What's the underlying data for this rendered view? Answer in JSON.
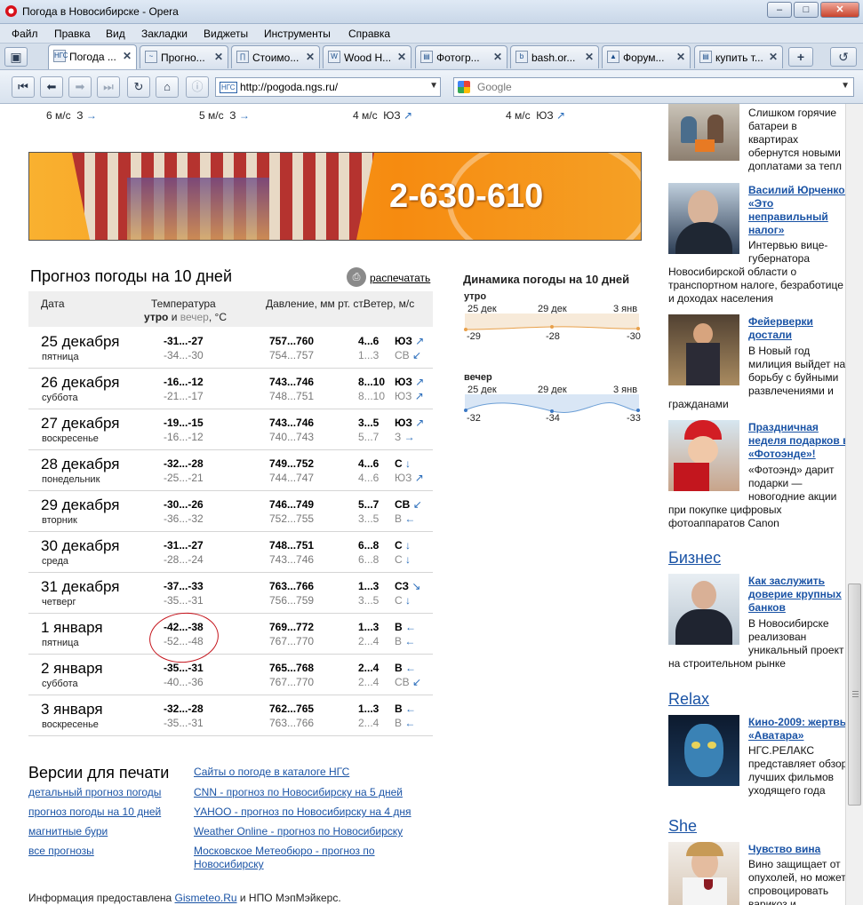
{
  "window": {
    "title": "Погода в Новосибирске - Opera",
    "minimize": "‒",
    "maximize": "□",
    "close": "✕"
  },
  "menu": [
    "Файл",
    "Правка",
    "Вид",
    "Закладки",
    "Виджеты",
    "Инструменты",
    "Справка"
  ],
  "tabs": [
    {
      "label": "Погода ...",
      "icon": "НГС",
      "active": true
    },
    {
      "label": "Прогно...",
      "icon": "~"
    },
    {
      "label": "Стоимо...",
      "icon": "∏"
    },
    {
      "label": "Wood H...",
      "icon": "W"
    },
    {
      "label": "Фотогр...",
      "icon": "▤"
    },
    {
      "label": "bash.or...",
      "icon": "b"
    },
    {
      "label": "Форум...",
      "icon": "▲"
    },
    {
      "label": "купить т...",
      "icon": "▤"
    }
  ],
  "address": {
    "url": "http://pogoda.ngs.ru/",
    "site_badge": "НГС",
    "search_placeholder": "Google"
  },
  "top_wind": [
    {
      "speed": "6 м/с",
      "dir": "З",
      "arrow": "→"
    },
    {
      "speed": "5 м/с",
      "dir": "З",
      "arrow": "→"
    },
    {
      "speed": "4 м/с",
      "dir": "ЮЗ",
      "arrow": "↗"
    },
    {
      "speed": "4 м/с",
      "dir": "ЮЗ",
      "arrow": "↗"
    }
  ],
  "banner": {
    "phone": "2-630-610"
  },
  "forecast": {
    "title": "Прогноз погоды на 10 дней",
    "print_label": "распечатать",
    "headers": {
      "date": "Дата",
      "temp_line1": "Температура",
      "temp_morning": "утро",
      "temp_and": " и ",
      "temp_evening": "вечер",
      "temp_unit": ", °С",
      "pressure": "Давление, мм рт. ст.",
      "wind": "Ветер, м/с"
    },
    "rows": [
      {
        "date": "25 декабря",
        "dow": "пятница",
        "t_m": "-31...-27",
        "t_e": "-34...-30",
        "p_m": "757...760",
        "p_e": "754...757",
        "w_m": "4...6",
        "w_e": "1...3",
        "d_m": "ЮЗ",
        "a_m": "↗",
        "d_e": "СВ",
        "a_e": "↙"
      },
      {
        "date": "26 декабря",
        "dow": "суббота",
        "t_m": "-16...-12",
        "t_e": "-21...-17",
        "p_m": "743...746",
        "p_e": "748...751",
        "w_m": "8...10",
        "w_e": "8...10",
        "d_m": "ЮЗ",
        "a_m": "↗",
        "d_e": "ЮЗ",
        "a_e": "↗"
      },
      {
        "date": "27 декабря",
        "dow": "воскресенье",
        "t_m": "-19...-15",
        "t_e": "-16...-12",
        "p_m": "743...746",
        "p_e": "740...743",
        "w_m": "3...5",
        "w_e": "5...7",
        "d_m": "ЮЗ",
        "a_m": "↗",
        "d_e": "З",
        "a_e": "→"
      },
      {
        "date": "28 декабря",
        "dow": "понедельник",
        "t_m": "-32...-28",
        "t_e": "-25...-21",
        "p_m": "749...752",
        "p_e": "744...747",
        "w_m": "4...6",
        "w_e": "4...6",
        "d_m": "С",
        "a_m": "↓",
        "d_e": "ЮЗ",
        "a_e": "↗"
      },
      {
        "date": "29 декабря",
        "dow": "вторник",
        "t_m": "-30...-26",
        "t_e": "-36...-32",
        "p_m": "746...749",
        "p_e": "752...755",
        "w_m": "5...7",
        "w_e": "3...5",
        "d_m": "СВ",
        "a_m": "↙",
        "d_e": "В",
        "a_e": "←"
      },
      {
        "date": "30 декабря",
        "dow": "среда",
        "t_m": "-31...-27",
        "t_e": "-28...-24",
        "p_m": "748...751",
        "p_e": "743...746",
        "w_m": "6...8",
        "w_e": "6...8",
        "d_m": "С",
        "a_m": "↓",
        "d_e": "С",
        "a_e": "↓"
      },
      {
        "date": "31 декабря",
        "dow": "четверг",
        "t_m": "-37...-33",
        "t_e": "-35...-31",
        "p_m": "763...766",
        "p_e": "756...759",
        "w_m": "1...3",
        "w_e": "3...5",
        "d_m": "СЗ",
        "a_m": "↘",
        "d_e": "С",
        "a_e": "↓"
      },
      {
        "date": "1 января",
        "dow": "пятница",
        "t_m": "-42...-38",
        "t_e": "-52...-48",
        "p_m": "769...772",
        "p_e": "767...770",
        "w_m": "1...3",
        "w_e": "2...4",
        "d_m": "В",
        "a_m": "←",
        "d_e": "В",
        "a_e": "←"
      },
      {
        "date": "2 января",
        "dow": "суббота",
        "t_m": "-35...-31",
        "t_e": "-40...-36",
        "p_m": "765...768",
        "p_e": "767...770",
        "w_m": "2...4",
        "w_e": "2...4",
        "d_m": "В",
        "a_m": "←",
        "d_e": "СВ",
        "a_e": "↙"
      },
      {
        "date": "3 января",
        "dow": "воскресенье",
        "t_m": "-32...-28",
        "t_e": "-35...-31",
        "p_m": "762...765",
        "p_e": "763...766",
        "w_m": "1...3",
        "w_e": "2...4",
        "d_m": "В",
        "a_m": "←",
        "d_e": "В",
        "a_e": "←"
      }
    ]
  },
  "dynamics": {
    "title": "Динамика погоды на 10 дней",
    "morning_label": "утро",
    "evening_label": "вечер",
    "dates": [
      "25 дек",
      "29 дек",
      "3 янв"
    ],
    "morning_values": [
      "-29",
      "-28",
      "-30"
    ],
    "evening_values": [
      "-32",
      "-34",
      "-33"
    ],
    "morning_color": "#e8a04a",
    "evening_color": "#6c9fd6"
  },
  "print_versions": {
    "title": "Версии для печати",
    "left_links": [
      "детальный прогноз погоды",
      "прогноз погоды на 10 дней",
      "магнитные бури",
      "все прогнозы"
    ],
    "right_links": [
      "Сайты о погоде в каталоге НГС",
      "CNN - прогноз по Новосибирску на 5 дней",
      "YAHOO - прогноз по Новосибирску на 4 дня",
      "Weather Online - прогноз по Новосибирску",
      "Московское Метеобюро - прогноз по",
      "Новосибирску"
    ]
  },
  "source": {
    "prefix": "Информация предоставлена ",
    "link": "Gismeteo.Ru",
    "suffix": " и НПО МэпМэйкерс."
  },
  "sidebar": {
    "news1_lines": [
      "Слишком горячие",
      "батареи в",
      "квартирах",
      "обернутся новыми",
      "доплатами за тепл"
    ],
    "news2_link": [
      "Василий Юрченко:",
      "«Это",
      "неправильный",
      "налог»"
    ],
    "news2_lines": [
      "Интервью вице-",
      "губернатора"
    ],
    "news2_wide": [
      "Новосибирской области о",
      "транспортном налоге, безработице",
      "и доходах населения"
    ],
    "news3_link": [
      "Фейерверки",
      "достали"
    ],
    "news3_lines": [
      "В Новый год",
      "милиция выйдет на",
      "борьбу с буйными",
      "развлечениями и"
    ],
    "news3_wide": [
      "гражданами"
    ],
    "news4_link": [
      "Праздничная",
      "неделя подарков в",
      "«Фотоэнде»!"
    ],
    "news4_lines": [
      "«Фотоэнд» дарит",
      "подарки —",
      "новогодние акции"
    ],
    "news4_wide": [
      "при покупке цифровых",
      "фотоаппаратов Canon"
    ],
    "biz_title": "Бизнес",
    "biz_link": [
      "Как заслужить",
      "доверие крупных",
      "банков"
    ],
    "biz_lines": [
      "В Новосибирске",
      "реализован",
      "уникальный проект"
    ],
    "biz_wide": [
      "на строительном рынке"
    ],
    "relax_title": "Relax",
    "relax_link": [
      "Кино-2009: жертвы",
      "«Аватара»"
    ],
    "relax_lines": [
      "НГС.РЕЛАКС",
      "представляет обзор",
      "лучших фильмов",
      "уходящего года"
    ],
    "she_title": "She",
    "she_link": [
      "Чувство вина"
    ],
    "she_lines": [
      "Вино защищает от",
      "опухолей, но может",
      "спровоцировать",
      "варикоз и..."
    ]
  }
}
